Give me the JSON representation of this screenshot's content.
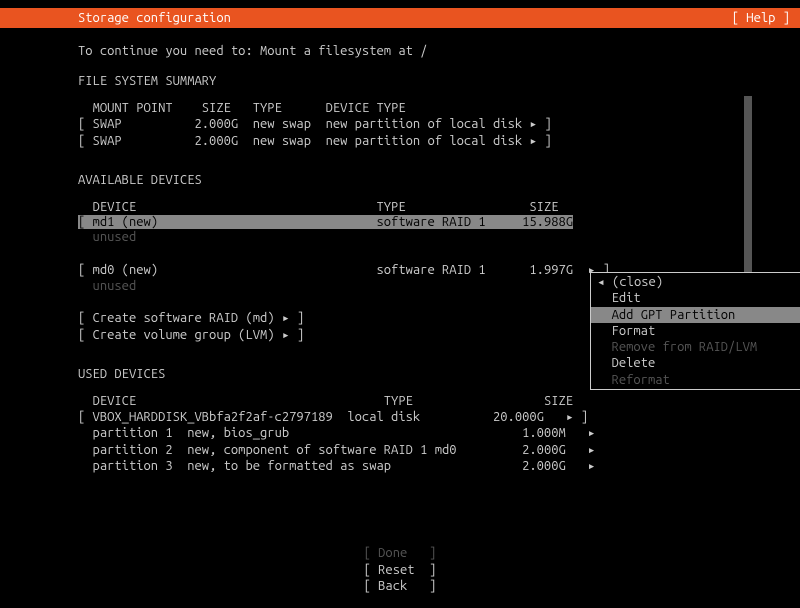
{
  "header": {
    "title": "Storage configuration",
    "help": "[ Help ]"
  },
  "instruction": "To continue you need to: Mount a filesystem at /",
  "sections": {
    "file_system_summary": {
      "title": "FILE SYSTEM SUMMARY",
      "col_mount": "MOUNT POINT",
      "col_size": "SIZE",
      "col_type": "TYPE",
      "col_devtype": "DEVICE TYPE",
      "rows": [
        {
          "mount": "[ SWAP",
          "size": "2.000G",
          "type": "new swap",
          "devtype": "new partition of local disk ▸ ]"
        },
        {
          "mount": "[ SWAP",
          "size": "2.000G",
          "type": "new swap",
          "devtype": "new partition of local disk ▸ ]"
        }
      ]
    },
    "available_devices": {
      "title": "AVAILABLE DEVICES",
      "col_device": "DEVICE",
      "col_type": "TYPE",
      "col_size": "SIZE",
      "rows": [
        {
          "device": "[ md1 (new)",
          "type": "software RAID 1",
          "size": "15.988G",
          "selected": true
        },
        {
          "device": "  unused",
          "dim": true
        },
        {
          "blank": true
        },
        {
          "device": "[ md0 (new)",
          "type": "software RAID 1",
          "size": "1.997G",
          "tail": "▸ ]"
        },
        {
          "device": "  unused",
          "dim": true
        }
      ],
      "actions": [
        "[ Create software RAID (md) ▸ ]",
        "[ Create volume group (LVM) ▸ ]"
      ]
    },
    "used_devices": {
      "title": "USED DEVICES",
      "col_device": "DEVICE",
      "col_type": "TYPE",
      "col_size": "SIZE",
      "disk": {
        "name": "[ VBOX_HARDDISK_VBbfa2f2af-c2797189",
        "type": "local disk",
        "size": "20.000G",
        "tail": "▸ ]"
      },
      "partitions": [
        {
          "name": "  partition 1",
          "desc": "new, bios_grub",
          "size": "1.000M"
        },
        {
          "name": "  partition 2",
          "desc": "new, component of software RAID 1 md0",
          "size": "2.000G"
        },
        {
          "name": "  partition 3",
          "desc": "new, to be formatted as swap",
          "size": "2.000G"
        }
      ]
    }
  },
  "popup": {
    "items": [
      {
        "label": "◂ (close)",
        "arrow": "",
        "dim": false,
        "sel": false
      },
      {
        "label": "Edit",
        "arrow": "▸",
        "dim": false,
        "sel": false,
        "indent": true
      },
      {
        "label": "Add GPT Partition",
        "arrow": "▸",
        "dim": false,
        "sel": true,
        "indent": true
      },
      {
        "label": "Format",
        "arrow": "▸",
        "dim": false,
        "sel": false,
        "indent": true
      },
      {
        "label": "Remove from RAID/LVM",
        "arrow": "",
        "dim": true,
        "sel": false,
        "indent": true
      },
      {
        "label": "Delete",
        "arrow": "▸",
        "dim": false,
        "sel": false,
        "indent": true
      },
      {
        "label": "Reformat",
        "arrow": "▸",
        "dim": true,
        "sel": false,
        "indent": true
      }
    ]
  },
  "footer": {
    "done": "[ Done   ]",
    "reset": "[ Reset  ]",
    "back": "[ Back   ]"
  }
}
